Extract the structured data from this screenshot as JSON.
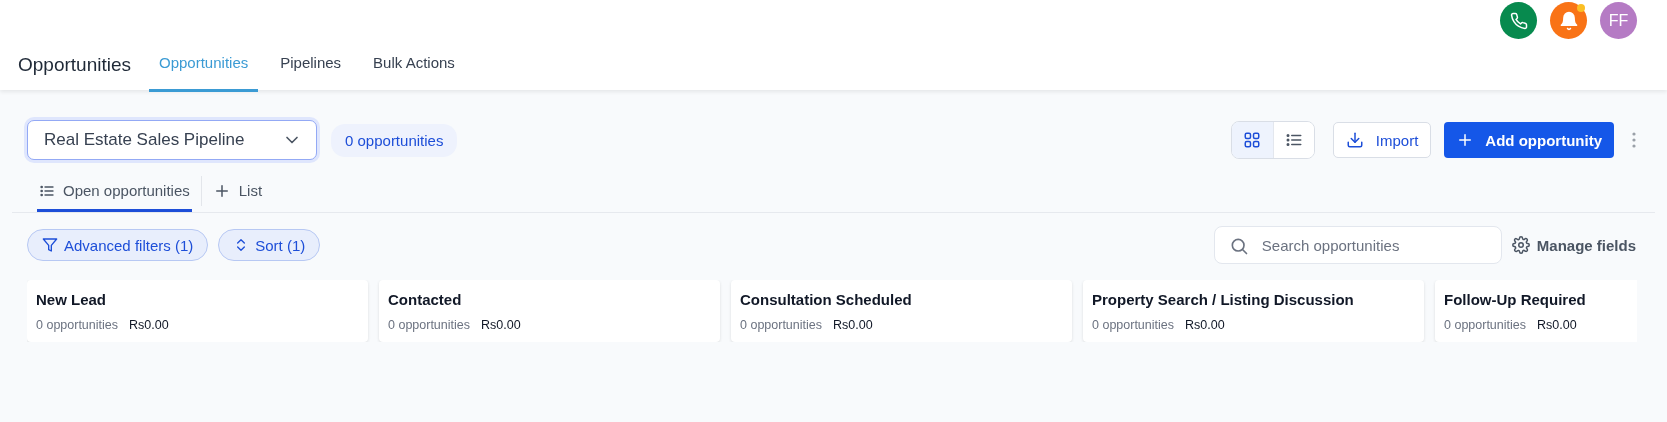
{
  "header": {
    "title": "Opportunities",
    "tabs": [
      {
        "label": "Opportunities",
        "selected": true
      },
      {
        "label": "Pipelines",
        "selected": false
      },
      {
        "label": "Bulk Actions",
        "selected": false
      }
    ],
    "avatar": "FF",
    "notification_dot": true
  },
  "toolbar": {
    "pipeline": "Real Estate Sales Pipeline",
    "count": "0 opportunities",
    "view_modes": [
      {
        "kind": "grid",
        "selected": true
      },
      {
        "kind": "list",
        "selected": false
      }
    ],
    "import": "Import",
    "add": "Add opportunity"
  },
  "subtabs": [
    {
      "label": "Open opportunities",
      "kind": "list",
      "selected": true
    },
    {
      "label": "List",
      "kind": "add",
      "selected": false
    }
  ],
  "filters": [
    {
      "label": "Advanced filters (1)",
      "kind": "filter"
    },
    {
      "label": "Sort (1)",
      "kind": "sort"
    }
  ],
  "search": {
    "placeholder": "Search opportunities"
  },
  "manage_fields": "Manage fields",
  "stages": [
    {
      "name": "New Lead",
      "count": "0 opportunities",
      "amount": "Rs0.00"
    },
    {
      "name": "Contacted",
      "count": "0 opportunities",
      "amount": "Rs0.00"
    },
    {
      "name": "Consultation Scheduled",
      "count": "0 opportunities",
      "amount": "Rs0.00"
    },
    {
      "name": "Property Search / Listing Discussion",
      "count": "0 opportunities",
      "amount": "Rs0.00"
    },
    {
      "name": "Follow-Up Required",
      "count": "0 opportunities",
      "amount": "Rs0.00"
    }
  ]
}
